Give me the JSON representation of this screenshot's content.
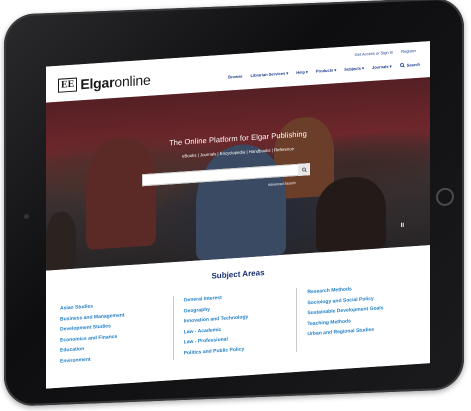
{
  "site": {
    "logo_mark": "EE",
    "logo_brand": "Elgar",
    "logo_suffix": "online"
  },
  "top_links": {
    "access": "Get Access or Sign In",
    "register": "Register"
  },
  "nav": {
    "items": [
      {
        "label": "Browse",
        "has_dropdown": false
      },
      {
        "label": "Librarian Services",
        "has_dropdown": true
      },
      {
        "label": "Help",
        "has_dropdown": true
      },
      {
        "label": "Products",
        "has_dropdown": true
      },
      {
        "label": "Subjects",
        "has_dropdown": true
      },
      {
        "label": "Journals",
        "has_dropdown": true
      }
    ],
    "search_label": "Search"
  },
  "hero": {
    "title": "The Online Platform for Elgar Publishing",
    "subtitle": "eBooks | Journals | Encyclopedia | Handbooks | Reference",
    "search_placeholder": "",
    "advanced_search": "Advanced Search",
    "pause": "II"
  },
  "subject_areas": {
    "title": "Subject Areas",
    "columns": [
      [
        "Asian Studies",
        "Business and Management",
        "Development Studies",
        "Economics and Finance",
        "Education",
        "Environment"
      ],
      [
        "General Interest",
        "Geography",
        "Innovation and Technology",
        "Law - Academic",
        "Law - Professional",
        "Politics and Public Policy"
      ],
      [
        "Research Methods",
        "Sociology and Social Policy",
        "Sustainable Development Goals",
        "Teaching Methods",
        "Urban and Regional Studies"
      ]
    ]
  },
  "colors": {
    "nav_blue": "#1a3a8a",
    "heading_navy": "#1a2f73",
    "link_blue": "#1f7ec6",
    "tablet_black": "#0e0e10"
  }
}
